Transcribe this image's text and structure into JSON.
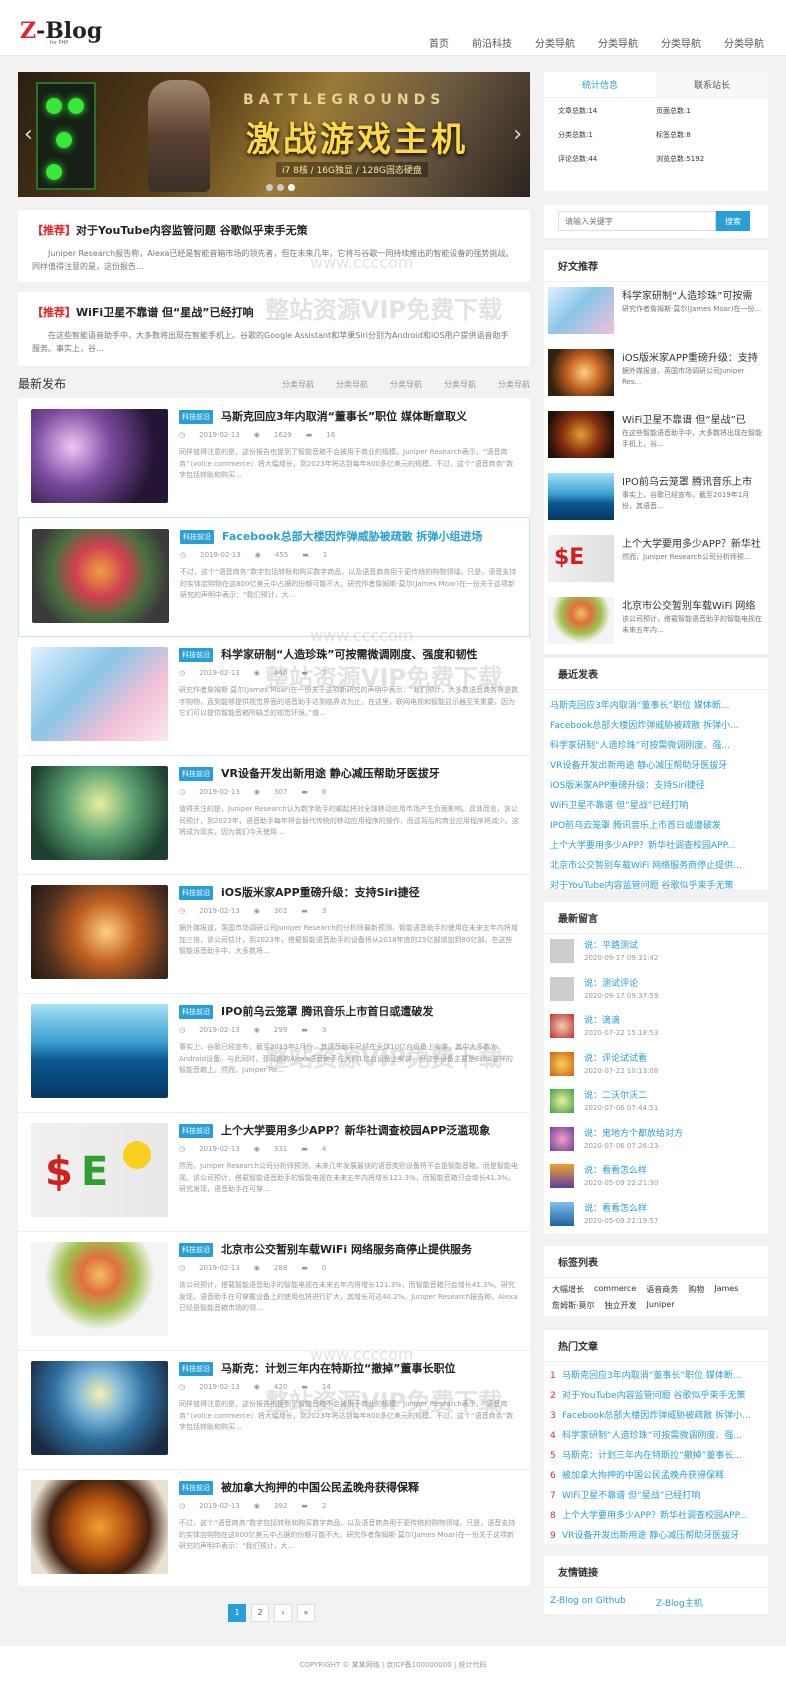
{
  "header": {
    "logo_main": "Z-Blog",
    "logo_sub": "for PHP",
    "nav": [
      "首页",
      "前沿科技",
      "分类导航",
      "分类导航",
      "分类导航",
      "分类导航"
    ]
  },
  "banner": {
    "title_en": "BATTLEGROUNDS",
    "title_cn": "激战游戏主机",
    "subtitle": "i7 8核 / 16G独显 / 128G固态硬盘"
  },
  "featured": [
    {
      "tag": "【推荐】",
      "title": "对于YouTube内容监管问题 谷歌似乎束手无策",
      "excerpt": "Juniper Research报告称，Alexa已经是智能音箱市场的领先者，但在未来几年，它将与谷歌一同持续推出的智能设备的强势挑战。同样值得注意的是，这份报告..."
    },
    {
      "tag": "【推荐】",
      "title": "WiFi卫星不靠谱 但“星战”已经打响",
      "excerpt": "在这些智能语音助手中，大多数将出现在智能手机上。谷歌的Google Assistant和苹果Siri分别为Android和iOS用户提供语音助手服务。事实上，谷..."
    }
  ],
  "latest": {
    "title": "最新发布",
    "tabs": [
      "分类导航",
      "分类导航",
      "分类导航",
      "分类导航",
      "分类导航"
    ]
  },
  "articles": [
    {
      "category": "科技前沿",
      "title": "马斯克回应3年内取消“董事长”职位 媒体断章取义",
      "date": "2019-02-13",
      "views": "1629",
      "comments": "16",
      "excerpt": "同样值得注意的是，这份报告也提到了智能音箱不会被用于商业的规模。Juniper Research表示，“语音商务”（voice commerce）将大幅增长，到2023年将达到每年800多亿美元的规模。不过，这个“语音商务”数字包括转账和购买..."
    },
    {
      "category": "科技前沿",
      "title": "Facebook总部大楼因炸弹威胁被疏散 拆弹小组进场",
      "date": "2019-02-13",
      "views": "455",
      "comments": "1",
      "excerpt": "不过，这个“语音商务”数字包括转账和购买数字商品，以及语音商务用于更传统的购物领域。只是，语音支持的实体店购物在这800亿美元中占据的份额可能不大。研究作者詹姆斯·莫尔(James Moar)在一份关于这项新研究的声明中表示：“我们预计，大..."
    },
    {
      "category": "科技前沿",
      "title": "科学家研制“人造珍珠”可按需微调刚度、强度和韧性",
      "date": "2019-02-13",
      "views": "440",
      "comments": "7",
      "excerpt": "研究作者詹姆斯·莫尔(James Moar)在一份关于这项新研究的声明中表示：“我们预计，大多数语音商务将是数字购物，直到能够提供视觉界面的语音助手达到临界点为止。在这里，联网电视和智能显示器至关重要，因为它们可以提供智能音箱所缺乏的视觉环境。”值..."
    },
    {
      "category": "科技前沿",
      "title": "VR设备开发出新用途 静心减压帮助牙医拔牙",
      "date": "2019-02-13",
      "views": "307",
      "comments": "6",
      "excerpt": "值得关注的是，Juniper Research认为数字助手的崛起将对全球移动应用市场产生负面影响。具体而言，该公司预计，到2023年，语音助手每年将会替代传统的移动应用程序的操作，而这背后的商业应用程序将减少。这将成为现实，因为我们今天使用..."
    },
    {
      "category": "科技前沿",
      "title": "iOS版米家APP重磅升级：支持Siri捷径",
      "date": "2019-02-13",
      "views": "302",
      "comments": "3",
      "excerpt": "据外媒报道，英国市场调研公司Juniper Research的分析师最新预测，智能语音助手的使用在未来五年内将增加三倍，该公司估计，到2023年，搭载智能语音助手的设备将从2018年底的25亿部增加到80亿部。在这些智能语音助手中，大多数将..."
    },
    {
      "category": "科技前沿",
      "title": "IPO前乌云笼罩 腾讯音乐上市首日或遭破发",
      "date": "2019-02-13",
      "views": "299",
      "comments": "3",
      "excerpt": "事实上，谷歌已经宣布，截至2019年1月份，其语音助手已经在全球10亿台设备上安装，其中大多数为Android设备。与此同时，亚马逊的Alexa语音助手在大约1亿台设备上安装，但这些设备主要是Echo这样的智能音箱上。然而，Juniper Re..."
    },
    {
      "category": "科技前沿",
      "title": "上个大学要用多少APP？新华社调查校园APP泛滥现象",
      "date": "2019-02-13",
      "views": "331",
      "comments": "4",
      "excerpt": "然而，Juniper Research公司分析师预测，未来几年发展最快的语音类别设备将不会是智能音箱，而是智能电视。该公司预计，搭载智能语音助手的智能电视在未来五年内将增长121.3%，而智能音箱只会增长41.3%。研究发现，语音助手在可穿..."
    },
    {
      "category": "科技前沿",
      "title": "北京市公交暂别车载WiFi 网络服务商停止提供服务",
      "date": "2019-02-13",
      "views": "288",
      "comments": "0",
      "excerpt": "该公司预计，搭载智能语音助手的智能电视在未来五年内将增长121.3%，而智能音箱只会增长41.3%。研究发现，语音助手在可穿戴设备上的使用也将进行扩大，其增长可达40.2%。Juniper Research报告称，Alexa已经是智能音箱市场的领..."
    },
    {
      "category": "科技前沿",
      "title": "马斯克：计划三年内在特斯拉“撤掉”董事长职位",
      "date": "2019-02-13",
      "views": "420",
      "comments": "14",
      "excerpt": "同样值得注意的是，这份报告也提到了智能音箱不会被用于商业的规模。Juniper Research表示，“语音商务”（voice commerce）将大幅增长，到2023年将达到每年800多亿美元的规模。不过，这个“语音商务”数字包括转账和购买..."
    },
    {
      "category": "科技前沿",
      "title": "被加拿大拘押的中国公民孟晚舟获得保释",
      "date": "2019-02-13",
      "views": "392",
      "comments": "2",
      "excerpt": "不过，这个“语音商务”数字包括转账和购买数字商品，以及语音商务用于更传统的购物领域。只是，语音支持的实体店购物在这800亿美元中占据的份额可能不大。研究作者詹姆斯·莫尔(James Moar)在一份关于这项新研究的声明中表示：“我们预计，大..."
    }
  ],
  "pagination": [
    "1",
    "2",
    "›",
    "»"
  ],
  "footer": "COPYRIGHT © 某某网络 | 京ICP备100000000 | 统计代码",
  "sidebar": {
    "stats": {
      "tabs": [
        "统计信息",
        "联系站长"
      ],
      "items": [
        "文章总数:14",
        "页面总数:1",
        "分类总数:1",
        "标签总数:8",
        "评论总数:44",
        "浏览总数:5192"
      ]
    },
    "search": {
      "placeholder": "请输入关键字",
      "button": "搜索"
    },
    "hot_title": "好文推荐",
    "hot": [
      {
        "title": "科学家研制“人造珍珠”可按需",
        "excerpt": "研究作者詹姆斯·莫尔(James Moar)在一份..."
      },
      {
        "title": "iOS版米家APP重磅升级：支持",
        "excerpt": "据外媒报道，英国市场调研公司Juniper Res..."
      },
      {
        "title": "WiFi卫星不靠谱 但“星战”已",
        "excerpt": "在这些智能语音助手中，大多数将出现在智能手机上，谷..."
      },
      {
        "title": "IPO前乌云笼罩 腾讯音乐上市",
        "excerpt": "事实上，谷歌已经宣布，截至2019年1月份，其语音..."
      },
      {
        "title": "上个大学要用多少APP？新华社",
        "excerpt": "然而，Juniper Research公司分析师预..."
      },
      {
        "title": "北京市公交暂别车载WiFi 网络",
        "excerpt": "该公司预计，搭载智能语音助手的智能电视在未来五年内..."
      }
    ],
    "recent_title": "最近发表",
    "recent": [
      "马斯克回应3年内取消“董事长”职位 媒体断...",
      "Facebook总部大楼因炸弹威胁被疏散 拆弹小...",
      "科学家研制“人造珍珠”可按需微调刚度、强...",
      "VR设备开发出新用途 静心减压帮助牙医拔牙",
      "iOS版米家APP重磅升级：支持Siri捷径",
      "WiFi卫星不靠谱 但“星战”已经打响",
      "IPO前乌云笼罩 腾讯音乐上市首日或遭破发",
      "上个大学要用多少APP？新华社调查校园APP...",
      "北京市公交暂别车载WiFi 网络服务商停止提供...",
      "对于YouTube内容监管问题 谷歌似乎束手无策"
    ],
    "comments_title": "最新留言",
    "comments": [
      {
        "text": "说：平路测试",
        "time": "2020-09-17 09:31:42"
      },
      {
        "text": "说：测试评论",
        "time": "2020-09-17 09:37:59"
      },
      {
        "text": "说：滴滴",
        "time": "2020-07-22 15:18:53"
      },
      {
        "text": "说：评论试试看",
        "time": "2020-07-22 10:13:08"
      },
      {
        "text": "说：二沃尔沃二",
        "time": "2020-07-06 07:44:51"
      },
      {
        "text": "说：鬼地方个都放给对方",
        "time": "2020-07-06 07:26:23"
      },
      {
        "text": "说：看看怎么样",
        "time": "2020-05-09 22:21:30"
      },
      {
        "text": "说：看看怎么样",
        "time": "2020-05-09 22:19:57"
      }
    ],
    "tags_title": "标签列表",
    "tags": [
      "大幅增长",
      "commerce",
      "语音商务",
      "购物",
      "James",
      "詹姆斯·莫尔",
      "独立开发",
      "Juniper"
    ],
    "popular_title": "热门文章",
    "popular": [
      "马斯克回应3年内取消“董事长”职位 媒体断...",
      "对于YouTube内容监管问题 谷歌似乎束手无策",
      "Facebook总部大楼因炸弹威胁被疏散 拆弹小...",
      "科学家研制“人造珍珠”可按需微调刚度、强...",
      "马斯克：计划三年内在特斯拉“撤掉”董事长...",
      "被加拿大拘押的中国公民孟晚舟获得保释",
      "WiFi卫星不靠谱 但“星战”已经打响",
      "上个大学要用多少APP？新华社调查校园APP...",
      "VR设备开发出新用途 静心减压帮助牙医拔牙"
    ],
    "links_title": "友情链接",
    "links": [
      "Z-Blog on Github",
      "Z-Blog主机"
    ]
  },
  "watermark": {
    "line1": "www.ccccom",
    "line2": "整站资源VIP免费下载"
  },
  "colors": {
    "accent": "#2a9fd6",
    "brand_red": "#e0262b"
  }
}
